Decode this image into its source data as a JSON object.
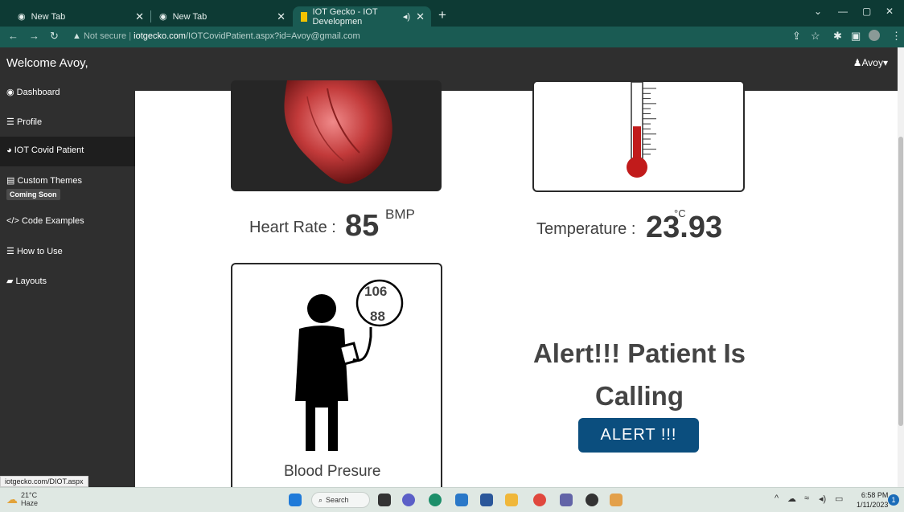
{
  "browser": {
    "tabs": [
      {
        "title": "New Tab",
        "active": false
      },
      {
        "title": "New Tab",
        "active": false
      },
      {
        "title": "IOT Gecko - IOT Developmen",
        "active": true
      }
    ],
    "address": {
      "security": "Not secure",
      "host": "iotgecko.com",
      "path": "/IOTCovidPatient.aspx?id=Avoy@gmail.com"
    },
    "status_url": "iotgecko.com/DIOT.aspx"
  },
  "header": {
    "welcome": "Welcome Avoy,",
    "user": "Avoy"
  },
  "sidebar": {
    "items": [
      {
        "label": "Dashboard",
        "icon": "dashboard-icon"
      },
      {
        "label": "Profile",
        "icon": "profile-icon"
      },
      {
        "label": "IOT Covid Patient",
        "icon": "globe-icon",
        "active": true
      },
      {
        "label": "Custom Themes",
        "icon": "document-icon",
        "badge": "Coming Soon"
      },
      {
        "label": "Code Examples",
        "icon": "code-icon"
      },
      {
        "label": "How to Use",
        "icon": "list-icon"
      },
      {
        "label": "Layouts",
        "icon": "layout-icon"
      }
    ]
  },
  "vitals": {
    "heart_rate_label": "Heart Rate :",
    "heart_rate_value": "85",
    "heart_rate_unit": "BMP",
    "temperature_label": "Temperature :",
    "temperature_value": "23.93",
    "temperature_unit": "°C",
    "thermometer_fill_fraction": 0.3,
    "bp_systolic": "106",
    "bp_diastolic": "88",
    "bp_label": "Blood Presure"
  },
  "alert": {
    "line1": "Alert!!! Patient Is",
    "line2": "Calling",
    "button": "ALERT  !!!"
  },
  "taskbar": {
    "weather_temp": "21°C",
    "weather_desc": "Haze",
    "search": "Search",
    "time": "6:58 PM",
    "date": "1/11/2023",
    "notification_count": "1"
  },
  "colors": {
    "tabbar": "#0d3a34",
    "addressbar": "#1a5b53",
    "sidebar": "#2f2f2f",
    "alert_button": "#0b4e7e",
    "thermometer": "#c11b1b"
  }
}
